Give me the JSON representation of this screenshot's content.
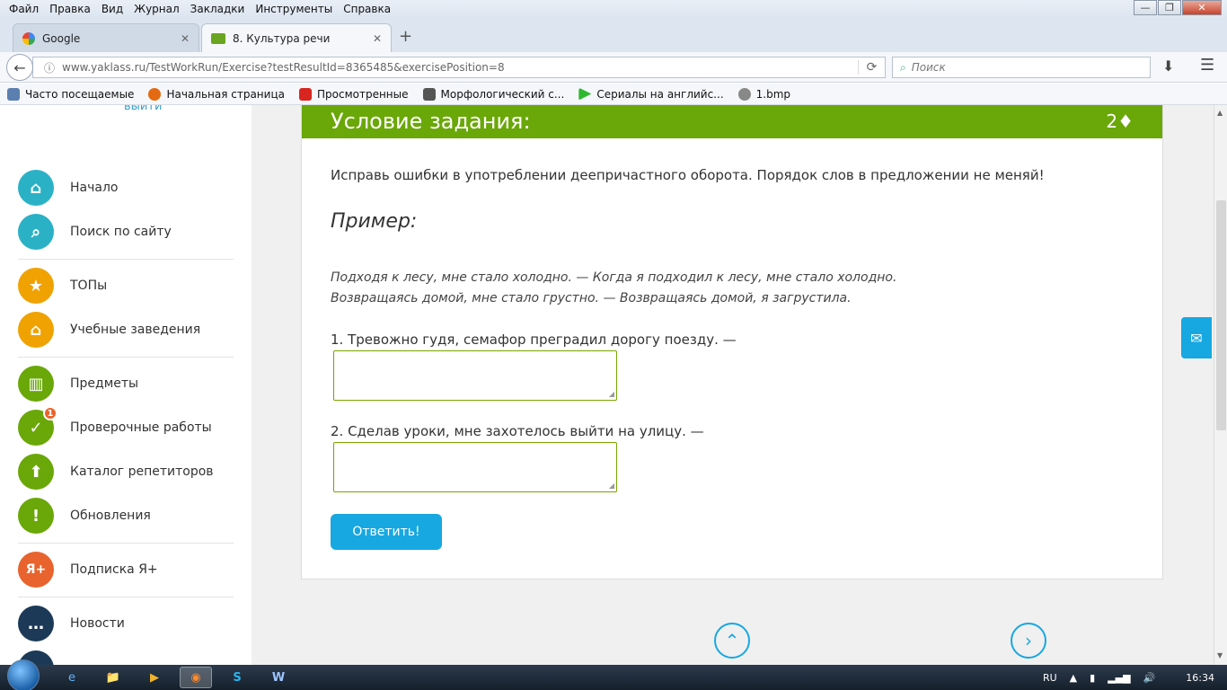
{
  "menu": [
    "Файл",
    "Правка",
    "Вид",
    "Журнал",
    "Закладки",
    "Инструменты",
    "Справка"
  ],
  "window_controls": {
    "minimize": "—",
    "maximize": "❐",
    "close": "✕"
  },
  "tabs": [
    {
      "title": "Google",
      "close": "✕"
    },
    {
      "title": "8. Культура речи",
      "close": "✕"
    }
  ],
  "new_tab": "+",
  "nav": {
    "back": "←",
    "url": "www.yaklass.ru/TestWorkRun/Exercise?testResultId=8365485&exercisePosition=8",
    "search_placeholder": "Поиск",
    "download": "⬇",
    "menu": "☰"
  },
  "bookmarks": [
    {
      "label": "Часто посещаемые",
      "color": "#5a7fb0"
    },
    {
      "label": "Начальная страница",
      "color": "#e36a12"
    },
    {
      "label": "Просмотренные",
      "color": "#d9251f"
    },
    {
      "label": "Морфологический с...",
      "color": "#555555"
    },
    {
      "label": "Сериалы на английс...",
      "color": "#2eb82e"
    },
    {
      "label": "1.bmp",
      "color": "#666666"
    }
  ],
  "sidebar": {
    "logout": "выйти",
    "items": [
      {
        "label": "Начало",
        "color": "#2bb1c6",
        "icon": "⌂"
      },
      {
        "label": "Поиск по сайту",
        "color": "#2bb1c6",
        "icon": "⌕"
      },
      {
        "label": "ТОПы",
        "color": "#f0a202",
        "icon": "★"
      },
      {
        "label": "Учебные заведения",
        "color": "#f0a202",
        "icon": "⌂"
      },
      {
        "label": "Предметы",
        "color": "#6aa708",
        "icon": "▥"
      },
      {
        "label": "Проверочные работы",
        "color": "#6aa708",
        "icon": "✓",
        "badge": "1"
      },
      {
        "label": "Каталог репетиторов",
        "color": "#6aa708",
        "icon": "⬆"
      },
      {
        "label": "Обновления",
        "color": "#6aa708",
        "icon": "!"
      },
      {
        "label": "Подписка Я+",
        "color": "#e8632e",
        "icon": "Я+"
      },
      {
        "label": "Новости",
        "color": "#1c3a57",
        "icon": "…"
      }
    ]
  },
  "card": {
    "title": "Условие задания:",
    "points": "2♦",
    "task": "Исправь ошибки в употреблении деепричастного оборота. Порядок слов в предложении не меняй!",
    "example_title": "Пример:",
    "example_lines": [
      "Подходя к лесу, мне стало холодно. — Когда я подходил к лесу, мне стало холодно.",
      "Возвращаясь домой, мне стало грустно. — Возвращаясь домой, я загрустила."
    ],
    "q1": "1. Тревожно гудя, семафор преградил дорогу поезду. —",
    "q2": "2. Сделав уроки, мне захотелось выйти на улицу. —",
    "answer1": "",
    "answer2": "",
    "submit": "Ответить!"
  },
  "pager": {
    "up": "⌃",
    "next": "›"
  },
  "mail_icon": "✉",
  "taskbar": {
    "apps": [
      "e",
      "📁",
      "▶",
      "◉",
      "S",
      "W"
    ],
    "lang": "RU",
    "time": "16:34"
  }
}
